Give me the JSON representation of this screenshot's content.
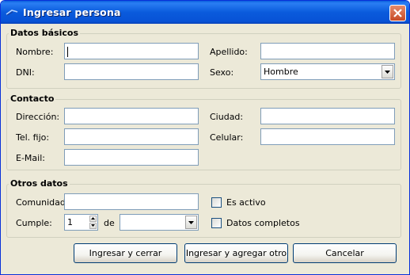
{
  "window": {
    "title": "Ingresar persona"
  },
  "groups": {
    "basic": {
      "title": "Datos básicos",
      "nombre_label": "Nombre:",
      "nombre_value": "",
      "apellido_label": "Apellido:",
      "apellido_value": "",
      "dni_label": "DNI:",
      "dni_value": "",
      "sexo_label": "Sexo:",
      "sexo_value": "Hombre"
    },
    "contact": {
      "title": "Contacto",
      "direccion_label": "Dirección:",
      "ciudad_label": "Ciudad:",
      "telfijo_label": "Tel. fijo:",
      "celular_label": "Celular:",
      "email_label": "E-Mail:"
    },
    "other": {
      "title": "Otros datos",
      "comunidad_label": "Comunidad:",
      "cumple_label": "Cumple:",
      "cumple_day": "1",
      "de_label": "de",
      "cumple_month": "",
      "activo_label": "Es activo",
      "activo_checked": false,
      "completos_label": "Datos completos",
      "completos_checked": false
    }
  },
  "buttons": {
    "save_close": "Ingresar y cerrar",
    "save_add": "Ingresar y agregar otro",
    "cancel": "Cancelar"
  }
}
